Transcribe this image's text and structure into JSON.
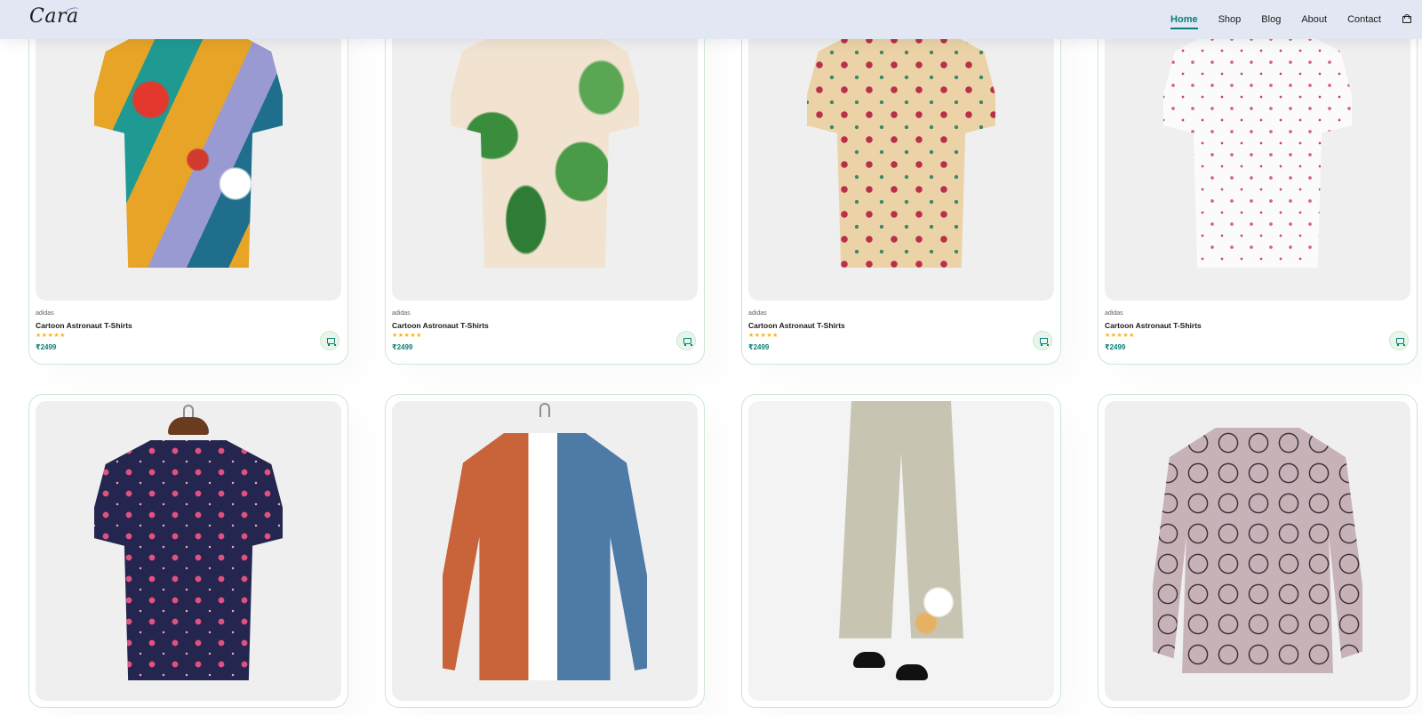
{
  "header": {
    "logo": "Cara",
    "nav": [
      "Home",
      "Shop",
      "Blog",
      "About",
      "Contact"
    ],
    "active": "Home",
    "icon": "bag-icon"
  },
  "colors": {
    "header_bg": "#e3e6f3",
    "accent": "#088178",
    "star": "#f3b519",
    "card_border": "#cce7d0"
  },
  "products": [
    {
      "brand": "adidas",
      "name": "Cartoon Astronaut T-Shirts",
      "stars": "★★★★★",
      "price": "₹2499",
      "image": "abstract-print-short-sleeve-shirt"
    },
    {
      "brand": "adidas",
      "name": "Cartoon Astronaut T-Shirts",
      "stars": "★★★★★",
      "price": "₹2499",
      "image": "leaf-lily-print-short-sleeve-shirt"
    },
    {
      "brand": "adidas",
      "name": "Cartoon Astronaut T-Shirts",
      "stars": "★★★★★",
      "price": "₹2499",
      "image": "beige-floral-short-sleeve-shirt"
    },
    {
      "brand": "adidas",
      "name": "Cartoon Astronaut T-Shirts",
      "stars": "★★★★★",
      "price": "₹2499",
      "image": "white-blossom-short-sleeve-shirt"
    },
    {
      "image": "navy-floral-short-sleeve-shirt"
    },
    {
      "image": "colorblock-corduroy-long-sleeve-shirt"
    },
    {
      "image": "linen-floral-cropped-pants"
    },
    {
      "image": "cat-print-long-sleeve-blouse"
    }
  ]
}
